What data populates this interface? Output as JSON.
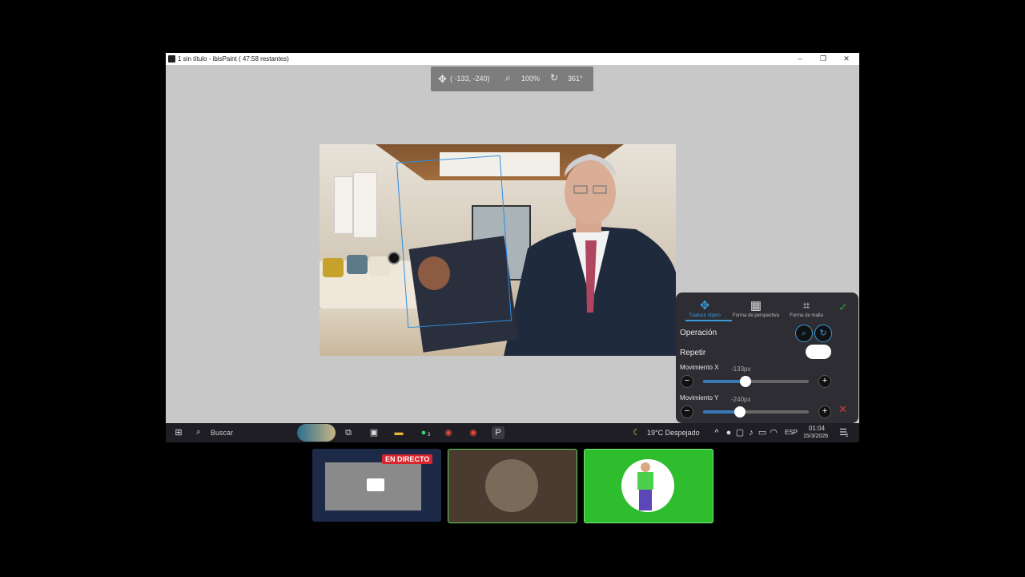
{
  "window": {
    "title": "1 sin título - ibisPaint ( 47:58 restantes)",
    "minimize": "–",
    "maximize": "❐",
    "close": "✕"
  },
  "toolbar": {
    "move_icon": "move-arrows",
    "coords": "( -133,  -240)",
    "zoom": "100%",
    "rotation": "361°"
  },
  "panel": {
    "tabs": [
      {
        "label": "Traducir objeto",
        "icon": "move-arrows-icon"
      },
      {
        "label": "Forma de perspectiva",
        "icon": "perspective-grid-icon"
      },
      {
        "label": "Forma de malla",
        "icon": "mesh-icon"
      }
    ],
    "confirm": "✓",
    "operation_label": "Operación",
    "repeat_label": "Repetir",
    "move_x_label": "Movimiento X",
    "move_x_value": "-133px",
    "move_x_level": 0.4,
    "move_y_label": "Movimiento Y",
    "move_y_value": "-240px",
    "move_y_level": 0.35,
    "cancel": "✕",
    "minus": "−",
    "plus": "+"
  },
  "taskbar": {
    "search_placeholder": "Buscar",
    "weather": "19°C  Despejado",
    "lang": "ESP",
    "time": "01:04",
    "date": "15/3/2026",
    "whatsapp_badge": "3",
    "notif_badge": "5"
  },
  "stream": {
    "live_badge": "EN DIRECTO"
  },
  "colors": {
    "accent": "#3a9ad9",
    "live": "#d8262e",
    "green_tile": "#2dbd2d"
  }
}
